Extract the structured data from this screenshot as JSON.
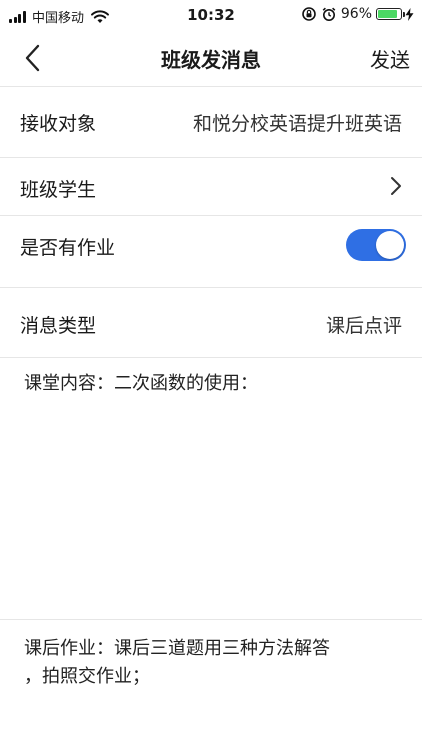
{
  "status_bar": {
    "carrier": "中国移动",
    "time": "10:32",
    "battery_percent": "96%",
    "battery_level": 0.96
  },
  "nav": {
    "title": "班级发消息",
    "send_label": "发送"
  },
  "form": {
    "recipient_label": "接收对象",
    "recipient_value": "和悦分校英语提升班英语",
    "students_label": "班级学生",
    "homework_label": "是否有作业",
    "homework_enabled": true,
    "message_type_label": "消息类型",
    "message_type_value": "课后点评"
  },
  "content": {
    "classroom_text": "课堂内容：二次函数的使用：",
    "after_class_text": "课后作业：课后三道题用三种方法解答\n，拍照交作业；"
  },
  "colors": {
    "accent": "#2f6fe4",
    "battery": "#4cd964",
    "divider": "#e6e6e6"
  }
}
